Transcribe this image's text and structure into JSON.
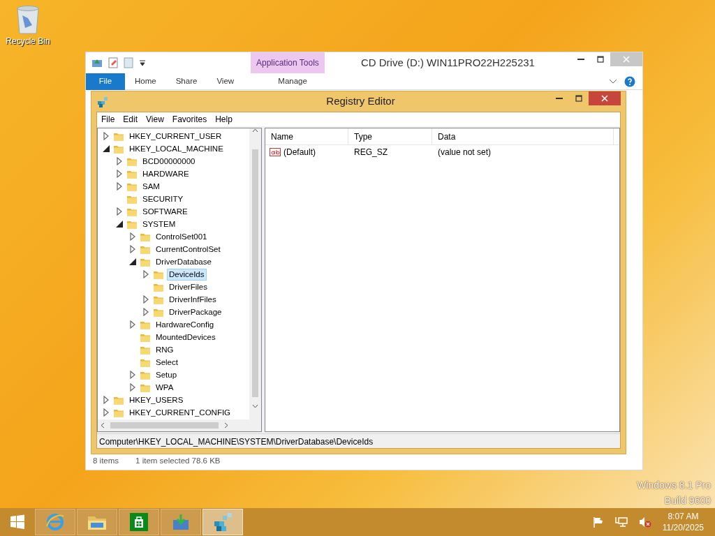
{
  "desktop": {
    "icons": [
      {
        "label": "Recycle Bin"
      }
    ],
    "watermark": [
      "Windows 8.1 Pro",
      "Build 9600"
    ]
  },
  "explorer": {
    "title": "CD Drive (D:) WIN11PRO22H225231",
    "contextual_header": "Application Tools",
    "tabs": [
      {
        "label": "File",
        "kind": "file",
        "selected": false
      },
      {
        "label": "Home",
        "kind": "plain",
        "selected": false
      },
      {
        "label": "Share",
        "kind": "plain",
        "selected": false
      },
      {
        "label": "View",
        "kind": "plain",
        "selected": false
      },
      {
        "label": "Manage",
        "kind": "contextual",
        "selected": false
      }
    ],
    "status_bar": [
      "8 items",
      "1 item selected  78.6 KB"
    ]
  },
  "regedit": {
    "title": "Registry Editor",
    "menu": [
      "File",
      "Edit",
      "View",
      "Favorites",
      "Help"
    ],
    "tree": [
      {
        "label": "HKEY_CURRENT_USER",
        "expandable": true,
        "expanded": false,
        "selected": false
      },
      {
        "label": "HKEY_LOCAL_MACHINE",
        "expandable": true,
        "expanded": true,
        "selected": false,
        "children": [
          {
            "label": "BCD00000000",
            "expandable": true,
            "expanded": false,
            "selected": false
          },
          {
            "label": "HARDWARE",
            "expandable": true,
            "expanded": false,
            "selected": false
          },
          {
            "label": "SAM",
            "expandable": true,
            "expanded": false,
            "selected": false
          },
          {
            "label": "SECURITY",
            "expandable": false,
            "selected": false
          },
          {
            "label": "SOFTWARE",
            "expandable": true,
            "expanded": false,
            "selected": false
          },
          {
            "label": "SYSTEM",
            "expandable": true,
            "expanded": true,
            "selected": false,
            "children": [
              {
                "label": "ControlSet001",
                "expandable": true,
                "expanded": false,
                "selected": false
              },
              {
                "label": "CurrentControlSet",
                "expandable": true,
                "expanded": false,
                "selected": false
              },
              {
                "label": "DriverDatabase",
                "expandable": true,
                "expanded": true,
                "selected": false,
                "children": [
                  {
                    "label": "DeviceIds",
                    "expandable": true,
                    "expanded": false,
                    "selected": true
                  },
                  {
                    "label": "DriverFiles",
                    "expandable": false,
                    "selected": false
                  },
                  {
                    "label": "DriverInfFiles",
                    "expandable": true,
                    "expanded": false,
                    "selected": false
                  },
                  {
                    "label": "DriverPackage",
                    "expandable": true,
                    "expanded": false,
                    "selected": false
                  }
                ]
              },
              {
                "label": "HardwareConfig",
                "expandable": true,
                "expanded": false,
                "selected": false
              },
              {
                "label": "MountedDevices",
                "expandable": false,
                "selected": false
              },
              {
                "label": "RNG",
                "expandable": false,
                "selected": false
              },
              {
                "label": "Select",
                "expandable": false,
                "selected": false
              },
              {
                "label": "Setup",
                "expandable": true,
                "expanded": false,
                "selected": false
              },
              {
                "label": "WPA",
                "expandable": true,
                "expanded": false,
                "selected": false
              }
            ]
          }
        ]
      },
      {
        "label": "HKEY_USERS",
        "expandable": true,
        "expanded": false,
        "selected": false
      },
      {
        "label": "HKEY_CURRENT_CONFIG",
        "expandable": true,
        "expanded": false,
        "selected": false
      }
    ],
    "columns": [
      "Name",
      "Type",
      "Data"
    ],
    "rows": [
      {
        "name": "(Default)",
        "type": "REG_SZ",
        "data": "(value not set)"
      }
    ],
    "status_bar": "Computer\\HKEY_LOCAL_MACHINE\\SYSTEM\\DriverDatabase\\DeviceIds"
  },
  "taskbar": {
    "apps": [
      {
        "kind": "start",
        "selected": false
      },
      {
        "kind": "browser",
        "selected": false
      },
      {
        "kind": "explorer",
        "selected": false
      },
      {
        "kind": "store",
        "selected": false
      },
      {
        "kind": "installer",
        "selected": false
      },
      {
        "kind": "regedit",
        "selected": true
      }
    ],
    "clock": {
      "time": "8:07 AM",
      "date": "11/20/2025"
    }
  }
}
